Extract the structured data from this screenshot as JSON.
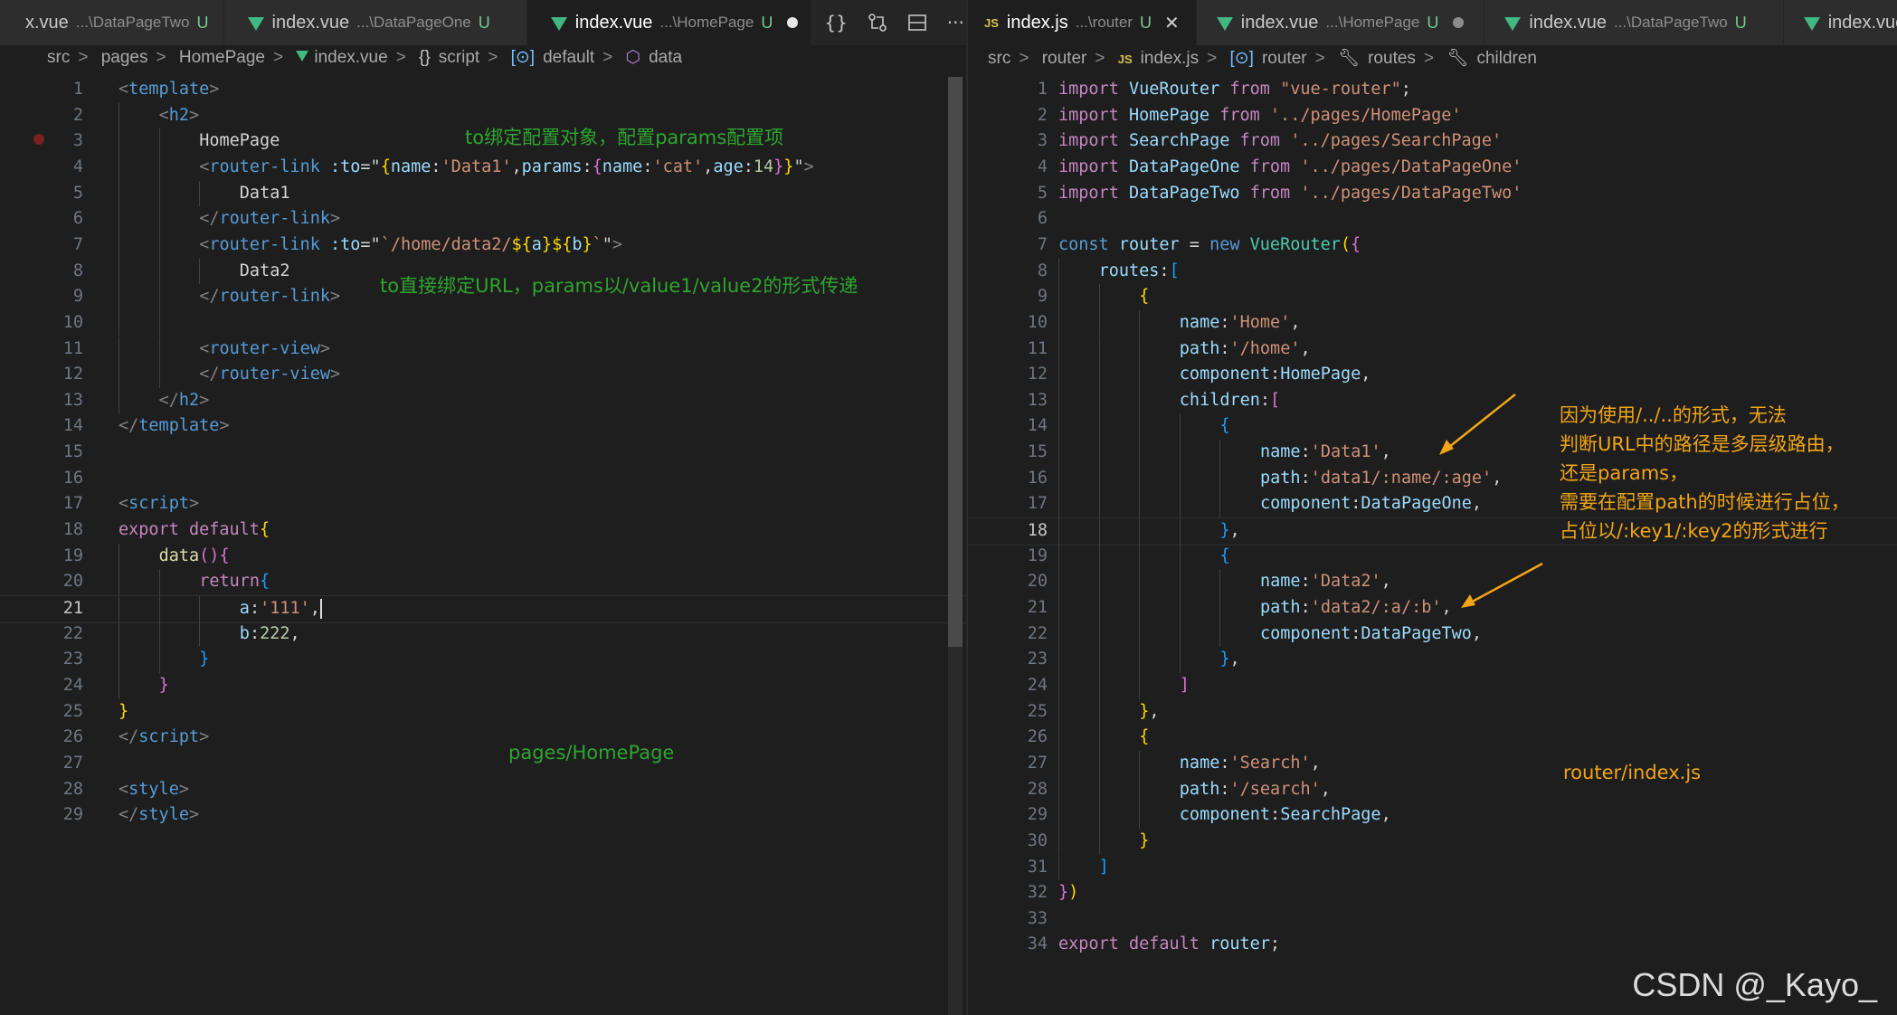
{
  "left": {
    "tabs": [
      {
        "name": "index.vue",
        "path": "...\\DataPageTwo",
        "state": "U",
        "partial": "x.vue"
      },
      {
        "name": "index.vue",
        "path": "...\\DataPageOne",
        "state": "U"
      },
      {
        "name": "index.vue",
        "path": "...\\HomePage",
        "state": "U",
        "active": true,
        "dirty": true
      }
    ],
    "breadcrumb": [
      "src",
      "pages",
      "HomePage",
      "index.vue",
      "script",
      "default",
      "data"
    ],
    "cursor_line": 21,
    "lines": [
      [
        [
          0,
          "t-tag",
          "<"
        ],
        [
          0,
          "t-tn",
          "template"
        ],
        [
          0,
          "t-tag",
          ">"
        ]
      ],
      [
        [
          1,
          "t-tag",
          "<"
        ],
        [
          1,
          "t-tn",
          "h2"
        ],
        [
          1,
          "t-tag",
          ">"
        ]
      ],
      [
        [
          2,
          "t-plain",
          "HomePage"
        ]
      ],
      [
        [
          2,
          "t-tag",
          "<"
        ],
        [
          2,
          "t-tn",
          "router-link"
        ],
        [
          2,
          "t-plain",
          " "
        ],
        [
          2,
          "t-attr",
          ":to"
        ],
        [
          2,
          "t-plain",
          "=\""
        ],
        [
          2,
          "t-b1",
          "{"
        ],
        [
          2,
          "t-var",
          "name"
        ],
        [
          2,
          "t-plain",
          ":"
        ],
        [
          2,
          "t-str",
          "'Data1'"
        ],
        [
          2,
          "t-plain",
          ","
        ],
        [
          2,
          "t-var",
          "params"
        ],
        [
          2,
          "t-plain",
          ":"
        ],
        [
          2,
          "t-b2",
          "{"
        ],
        [
          2,
          "t-var",
          "name"
        ],
        [
          2,
          "t-plain",
          ":"
        ],
        [
          2,
          "t-str",
          "'cat'"
        ],
        [
          2,
          "t-plain",
          ","
        ],
        [
          2,
          "t-var",
          "age"
        ],
        [
          2,
          "t-plain",
          ":"
        ],
        [
          2,
          "t-num",
          "14"
        ],
        [
          2,
          "t-b2",
          "}"
        ],
        [
          2,
          "t-b1",
          "}"
        ],
        [
          2,
          "t-plain",
          "\""
        ],
        [
          2,
          "t-tag",
          ">"
        ]
      ],
      [
        [
          3,
          "t-plain",
          "Data1"
        ]
      ],
      [
        [
          2,
          "t-tag",
          "</"
        ],
        [
          2,
          "t-tn",
          "router-link"
        ],
        [
          2,
          "t-tag",
          ">"
        ]
      ],
      [
        [
          2,
          "t-tag",
          "<"
        ],
        [
          2,
          "t-tn",
          "router-link"
        ],
        [
          2,
          "t-plain",
          " "
        ],
        [
          2,
          "t-attr",
          ":to"
        ],
        [
          2,
          "t-plain",
          "=\""
        ],
        [
          2,
          "t-str",
          "`/home/data2/"
        ],
        [
          2,
          "t-b1",
          "${"
        ],
        [
          2,
          "t-var",
          "a"
        ],
        [
          2,
          "t-b1",
          "}"
        ],
        [
          2,
          "t-b1",
          "${"
        ],
        [
          2,
          "t-var",
          "b"
        ],
        [
          2,
          "t-b1",
          "}"
        ],
        [
          2,
          "t-str",
          "`"
        ],
        [
          2,
          "t-plain",
          "\""
        ],
        [
          2,
          "t-tag",
          ">"
        ]
      ],
      [
        [
          3,
          "t-plain",
          "Data2"
        ]
      ],
      [
        [
          2,
          "t-tag",
          "</"
        ],
        [
          2,
          "t-tn",
          "router-link"
        ],
        [
          2,
          "t-tag",
          ">"
        ]
      ],
      [],
      [
        [
          2,
          "t-tag",
          "<"
        ],
        [
          2,
          "t-tn",
          "router-view"
        ],
        [
          2,
          "t-tag",
          ">"
        ]
      ],
      [
        [
          2,
          "t-tag",
          "</"
        ],
        [
          2,
          "t-tn",
          "router-view"
        ],
        [
          2,
          "t-tag",
          ">"
        ]
      ],
      [
        [
          1,
          "t-tag",
          "</"
        ],
        [
          1,
          "t-tn",
          "h2"
        ],
        [
          1,
          "t-tag",
          ">"
        ]
      ],
      [
        [
          0,
          "t-tag",
          "</"
        ],
        [
          0,
          "t-tn",
          "template"
        ],
        [
          0,
          "t-tag",
          ">"
        ]
      ],
      [],
      [],
      [
        [
          0,
          "t-tag",
          "<"
        ],
        [
          0,
          "t-tn",
          "script"
        ],
        [
          0,
          "t-tag",
          ">"
        ]
      ],
      [
        [
          0,
          "t-kw",
          "export"
        ],
        [
          0,
          "t-plain",
          " "
        ],
        [
          0,
          "t-kw",
          "default"
        ],
        [
          0,
          "t-b1",
          "{"
        ]
      ],
      [
        [
          1,
          "t-fn",
          "data"
        ],
        [
          1,
          "t-b2",
          "()"
        ],
        [
          1,
          "t-b2",
          "{"
        ]
      ],
      [
        [
          2,
          "t-kw",
          "return"
        ],
        [
          2,
          "t-b3",
          "{"
        ]
      ],
      [
        [
          3,
          "t-var",
          "a"
        ],
        [
          3,
          "t-plain",
          ":"
        ],
        [
          3,
          "t-str",
          "'111'"
        ],
        [
          3,
          "t-plain",
          ","
        ]
      ],
      [
        [
          3,
          "t-var",
          "b"
        ],
        [
          3,
          "t-plain",
          ":"
        ],
        [
          3,
          "t-num",
          "222"
        ],
        [
          3,
          "t-plain",
          ","
        ]
      ],
      [
        [
          2,
          "t-b3",
          "}"
        ]
      ],
      [
        [
          1,
          "t-b2",
          "}"
        ]
      ],
      [
        [
          0,
          "t-b1",
          "}"
        ]
      ],
      [
        [
          0,
          "t-tag",
          "</"
        ],
        [
          0,
          "t-tn",
          "script"
        ],
        [
          0,
          "t-tag",
          ">"
        ]
      ],
      [],
      [
        [
          0,
          "t-tag",
          "<"
        ],
        [
          0,
          "t-tn",
          "style"
        ],
        [
          0,
          "t-tag",
          ">"
        ]
      ],
      [
        [
          0,
          "t-tag",
          "</"
        ],
        [
          0,
          "t-tn",
          "style"
        ],
        [
          0,
          "t-tag",
          ">"
        ]
      ]
    ],
    "annotations": [
      {
        "text": "to绑定配置对象，配置params配置项",
        "line": 2
      },
      {
        "text": "to直接绑定URL，params以/value1/value2的形式传递",
        "line": 9
      },
      {
        "text": "pages/HomePage",
        "line": 27
      }
    ]
  },
  "right": {
    "tabs": [
      {
        "name": "index.js",
        "path": "...\\router",
        "state": "U",
        "active": true,
        "js": true
      },
      {
        "name": "index.vue",
        "path": "...\\HomePage",
        "state": "U",
        "dirty": true
      },
      {
        "name": "index.vue",
        "path": "...\\DataPageTwo",
        "state": "U"
      },
      {
        "name": "index.vue"
      }
    ],
    "breadcrumb": [
      "src",
      "router",
      "index.js",
      "router",
      "routes",
      "children"
    ],
    "cursor_line": 18,
    "lines": [
      [
        [
          0,
          "t-kw",
          "import"
        ],
        [
          0,
          "t-plain",
          " "
        ],
        [
          0,
          "t-var",
          "VueRouter"
        ],
        [
          0,
          "t-plain",
          " "
        ],
        [
          0,
          "t-kw",
          "from"
        ],
        [
          0,
          "t-plain",
          " "
        ],
        [
          0,
          "t-str",
          "\"vue-router\""
        ],
        [
          0,
          "t-plain",
          ";"
        ]
      ],
      [
        [
          0,
          "t-kw",
          "import"
        ],
        [
          0,
          "t-plain",
          " "
        ],
        [
          0,
          "t-var",
          "HomePage"
        ],
        [
          0,
          "t-plain",
          " "
        ],
        [
          0,
          "t-kw",
          "from"
        ],
        [
          0,
          "t-plain",
          " "
        ],
        [
          0,
          "t-str",
          "'../pages/HomePage'"
        ]
      ],
      [
        [
          0,
          "t-kw",
          "import"
        ],
        [
          0,
          "t-plain",
          " "
        ],
        [
          0,
          "t-var",
          "SearchPage"
        ],
        [
          0,
          "t-plain",
          " "
        ],
        [
          0,
          "t-kw",
          "from"
        ],
        [
          0,
          "t-plain",
          " "
        ],
        [
          0,
          "t-str",
          "'../pages/SearchPage'"
        ]
      ],
      [
        [
          0,
          "t-kw",
          "import"
        ],
        [
          0,
          "t-plain",
          " "
        ],
        [
          0,
          "t-var",
          "DataPageOne"
        ],
        [
          0,
          "t-plain",
          " "
        ],
        [
          0,
          "t-kw",
          "from"
        ],
        [
          0,
          "t-plain",
          " "
        ],
        [
          0,
          "t-str",
          "'../pages/DataPageOne'"
        ]
      ],
      [
        [
          0,
          "t-kw",
          "import"
        ],
        [
          0,
          "t-plain",
          " "
        ],
        [
          0,
          "t-var",
          "DataPageTwo"
        ],
        [
          0,
          "t-plain",
          " "
        ],
        [
          0,
          "t-kw",
          "from"
        ],
        [
          0,
          "t-plain",
          " "
        ],
        [
          0,
          "t-str",
          "'../pages/DataPageTwo'"
        ]
      ],
      [],
      [
        [
          0,
          "t-blue",
          "const"
        ],
        [
          0,
          "t-plain",
          " "
        ],
        [
          0,
          "t-var",
          "router"
        ],
        [
          0,
          "t-plain",
          " = "
        ],
        [
          0,
          "t-blue",
          "new"
        ],
        [
          0,
          "t-plain",
          " "
        ],
        [
          0,
          "t-cls",
          "VueRouter"
        ],
        [
          0,
          "t-b1",
          "("
        ],
        [
          0,
          "t-b2",
          "{"
        ]
      ],
      [
        [
          1,
          "t-var",
          "routes"
        ],
        [
          1,
          "t-plain",
          ":"
        ],
        [
          1,
          "t-b3",
          "["
        ]
      ],
      [
        [
          2,
          "t-b1",
          "{"
        ]
      ],
      [
        [
          3,
          "t-var",
          "name"
        ],
        [
          3,
          "t-plain",
          ":"
        ],
        [
          3,
          "t-str",
          "'Home'"
        ],
        [
          3,
          "t-plain",
          ","
        ]
      ],
      [
        [
          3,
          "t-var",
          "path"
        ],
        [
          3,
          "t-plain",
          ":"
        ],
        [
          3,
          "t-str",
          "'/home'"
        ],
        [
          3,
          "t-plain",
          ","
        ]
      ],
      [
        [
          3,
          "t-var",
          "component"
        ],
        [
          3,
          "t-plain",
          ":"
        ],
        [
          3,
          "t-var",
          "HomePage"
        ],
        [
          3,
          "t-plain",
          ","
        ]
      ],
      [
        [
          3,
          "t-var",
          "children"
        ],
        [
          3,
          "t-plain",
          ":"
        ],
        [
          3,
          "t-b2",
          "["
        ]
      ],
      [
        [
          4,
          "t-b3",
          "{"
        ]
      ],
      [
        [
          5,
          "t-var",
          "name"
        ],
        [
          5,
          "t-plain",
          ":"
        ],
        [
          5,
          "t-str",
          "'Data1'"
        ],
        [
          5,
          "t-plain",
          ","
        ]
      ],
      [
        [
          5,
          "t-var",
          "path"
        ],
        [
          5,
          "t-plain",
          ":"
        ],
        [
          5,
          "t-str",
          "'data1/:name/:age'"
        ],
        [
          5,
          "t-plain",
          ","
        ]
      ],
      [
        [
          5,
          "t-var",
          "component"
        ],
        [
          5,
          "t-plain",
          ":"
        ],
        [
          5,
          "t-var",
          "DataPageOne"
        ],
        [
          5,
          "t-plain",
          ","
        ]
      ],
      [
        [
          4,
          "t-b3",
          "}"
        ],
        [
          4,
          "t-plain",
          ","
        ]
      ],
      [
        [
          4,
          "t-b3",
          "{"
        ]
      ],
      [
        [
          5,
          "t-var",
          "name"
        ],
        [
          5,
          "t-plain",
          ":"
        ],
        [
          5,
          "t-str",
          "'Data2'"
        ],
        [
          5,
          "t-plain",
          ","
        ]
      ],
      [
        [
          5,
          "t-var",
          "path"
        ],
        [
          5,
          "t-plain",
          ":"
        ],
        [
          5,
          "t-str",
          "'data2/:a/:b'"
        ],
        [
          5,
          "t-plain",
          ","
        ]
      ],
      [
        [
          5,
          "t-var",
          "component"
        ],
        [
          5,
          "t-plain",
          ":"
        ],
        [
          5,
          "t-var",
          "DataPageTwo"
        ],
        [
          5,
          "t-plain",
          ","
        ]
      ],
      [
        [
          4,
          "t-b3",
          "}"
        ],
        [
          4,
          "t-plain",
          ","
        ]
      ],
      [
        [
          3,
          "t-b2",
          "]"
        ]
      ],
      [
        [
          2,
          "t-b1",
          "}"
        ],
        [
          2,
          "t-plain",
          ","
        ]
      ],
      [
        [
          2,
          "t-b1",
          "{"
        ]
      ],
      [
        [
          3,
          "t-var",
          "name"
        ],
        [
          3,
          "t-plain",
          ":"
        ],
        [
          3,
          "t-str",
          "'Search'"
        ],
        [
          3,
          "t-plain",
          ","
        ]
      ],
      [
        [
          3,
          "t-var",
          "path"
        ],
        [
          3,
          "t-plain",
          ":"
        ],
        [
          3,
          "t-str",
          "'/search'"
        ],
        [
          3,
          "t-plain",
          ","
        ]
      ],
      [
        [
          3,
          "t-var",
          "component"
        ],
        [
          3,
          "t-plain",
          ":"
        ],
        [
          3,
          "t-var",
          "SearchPage"
        ],
        [
          3,
          "t-plain",
          ","
        ]
      ],
      [
        [
          2,
          "t-b1",
          "}"
        ]
      ],
      [
        [
          1,
          "t-b3",
          "]"
        ]
      ],
      [
        [
          0,
          "t-b2",
          "}"
        ],
        [
          0,
          "t-b1",
          ")"
        ]
      ],
      [],
      [
        [
          0,
          "t-kw",
          "export"
        ],
        [
          0,
          "t-plain",
          " "
        ],
        [
          0,
          "t-kw",
          "default"
        ],
        [
          0,
          "t-plain",
          " "
        ],
        [
          0,
          "t-var",
          "router"
        ],
        [
          0,
          "t-plain",
          ";"
        ]
      ]
    ],
    "annotation_lines": [
      "因为使用/../..的形式，无法",
      "判断URL中的路径是多层级路由，",
      "还是params，",
      "需要在配置path的时候进行占位，",
      "占位以/:key1/:key2的形式进行"
    ],
    "annotation_label": "router/index.js"
  },
  "watermark": "CSDN @_Kayo_",
  "colors": {
    "annotation_green": "#2ea52e",
    "annotation_orange": "#f2a515",
    "vue_green": "#41b883",
    "js_yellow": "#d4c44c"
  }
}
